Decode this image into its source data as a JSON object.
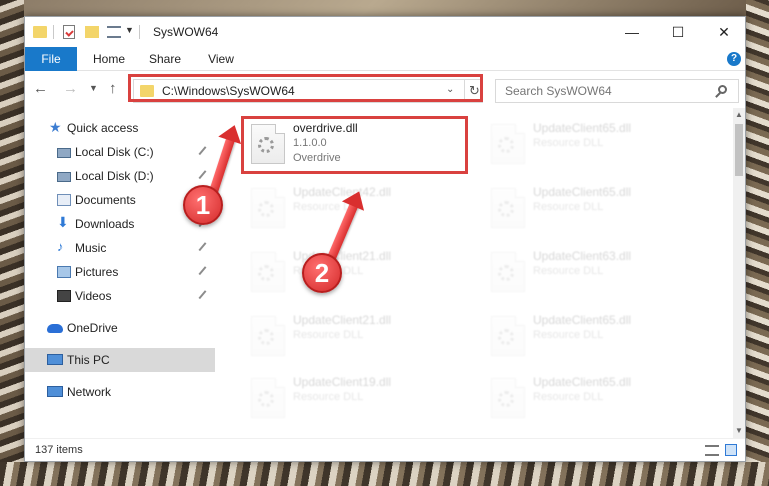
{
  "window": {
    "title": "SysWOW64",
    "controls": {
      "minimize": "—",
      "maximize": "☐",
      "close": "✕"
    }
  },
  "ribbon": {
    "tabs": [
      "File",
      "Home",
      "Share",
      "View"
    ],
    "help": "?"
  },
  "address": {
    "path": "C:\\Windows\\SysWOW64",
    "refresh": "↻",
    "dropdown": "⌄"
  },
  "nav_buttons": {
    "back": "←",
    "forward": "→",
    "recent": "⌄",
    "up": "↑"
  },
  "search": {
    "placeholder": "Search SysWOW64"
  },
  "sidebar": {
    "items": [
      {
        "label": "Quick access",
        "pinned": false
      },
      {
        "label": "Local Disk (C:)",
        "pinned": true
      },
      {
        "label": "Local Disk (D:)",
        "pinned": true
      },
      {
        "label": "Documents",
        "pinned": true
      },
      {
        "label": "Downloads",
        "pinned": true
      },
      {
        "label": "Music",
        "pinned": true
      },
      {
        "label": "Pictures",
        "pinned": true
      },
      {
        "label": "Videos",
        "pinned": true
      },
      {
        "label": "OneDrive",
        "pinned": false
      },
      {
        "label": "This PC",
        "pinned": false,
        "selected": true
      },
      {
        "label": "Network",
        "pinned": false
      }
    ]
  },
  "files": {
    "highlighted": {
      "name": "overdrive.dll",
      "version": "1.1.0.0",
      "description": "Overdrive"
    },
    "background": [
      {
        "name": "UpdateClient65.dll",
        "type": "Resource DLL"
      },
      {
        "name": "UpdateClient42.dll",
        "type": "Resource DLL"
      },
      {
        "name": "UpdateClient65.dll",
        "type": "Resource DLL"
      },
      {
        "name": "UpdateClient21.dll",
        "type": "Resource DLL"
      },
      {
        "name": "UpdateClient63.dll",
        "type": "Resource DLL"
      },
      {
        "name": "UpdateClient21.dll",
        "type": "Resource DLL"
      },
      {
        "name": "UpdateClient65.dll",
        "type": "Resource DLL"
      },
      {
        "name": "UpdateClient19.dll",
        "type": "Resource DLL"
      },
      {
        "name": "UpdateClient65.dll",
        "type": "Resource DLL"
      }
    ]
  },
  "status": {
    "item_count": "137 items"
  },
  "annotations": {
    "step1": "1",
    "step2": "2",
    "color": "#d9413f"
  }
}
